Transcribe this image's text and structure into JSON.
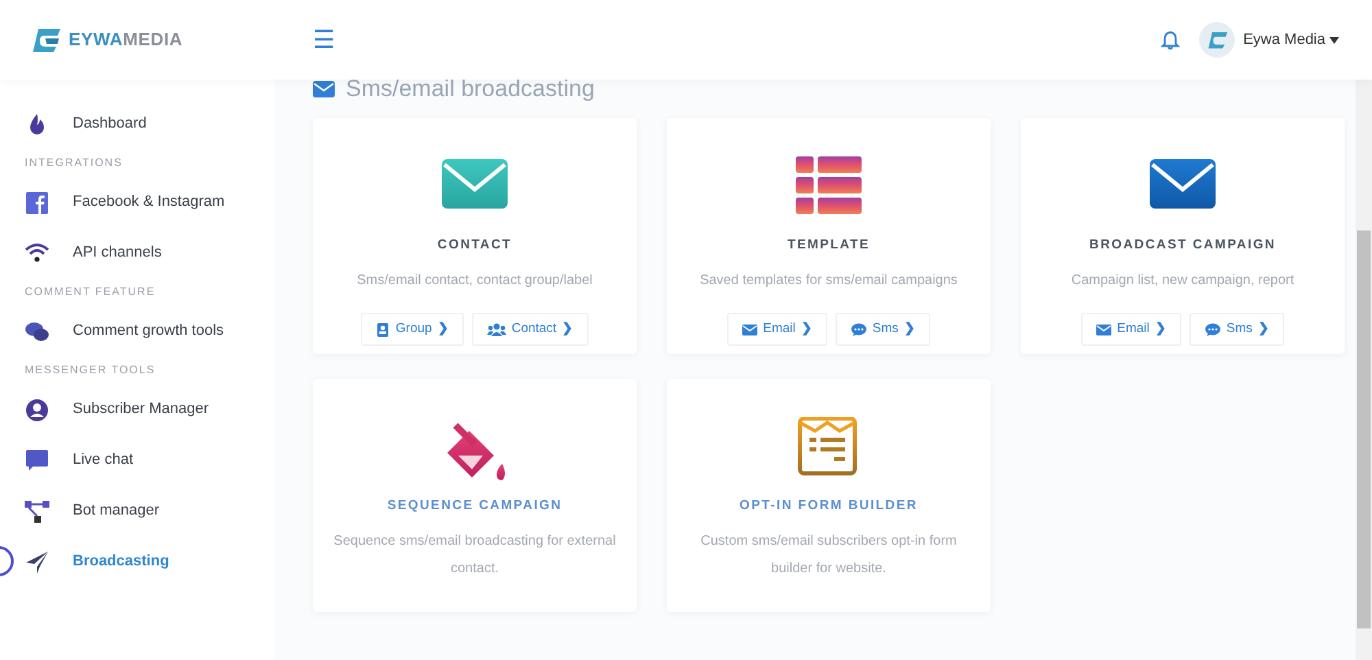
{
  "brand": {
    "logo_text_a": "EYWA",
    "logo_text_b": "MEDIA"
  },
  "header": {
    "menu_icon": "☰",
    "user_name": "Eywa Media"
  },
  "sidebar": {
    "items": [
      {
        "kind": "item",
        "label": "Dashboard",
        "selected": false
      },
      {
        "kind": "section",
        "label": "INTEGRATIONS"
      },
      {
        "kind": "item",
        "label": "Facebook & Instagram",
        "selected": false
      },
      {
        "kind": "item",
        "label": "API channels",
        "selected": false
      },
      {
        "kind": "section",
        "label": "COMMENT FEATURE"
      },
      {
        "kind": "item",
        "label": "Comment growth tools",
        "selected": false
      },
      {
        "kind": "section",
        "label": "MESSENGER TOOLS"
      },
      {
        "kind": "item",
        "label": "Subscriber Manager",
        "selected": false
      },
      {
        "kind": "item",
        "label": "Live chat",
        "selected": false
      },
      {
        "kind": "item",
        "label": "Bot manager",
        "selected": false
      },
      {
        "kind": "item",
        "label": "Broadcasting",
        "selected": true
      }
    ]
  },
  "page_title": "Sms/email broadcasting",
  "cards": [
    {
      "title": "CONTACT",
      "color": "#4a5563",
      "description": "Sms/email contact, contact group/label",
      "buttons": [
        {
          "kind": "group",
          "label": "Group",
          "arrow": "❯"
        },
        {
          "kind": "contact",
          "label": "Contact",
          "arrow": "❯"
        }
      ]
    },
    {
      "title": "TEMPLATE",
      "color": "#4a5563",
      "description": "Saved templates for sms/email campaigns",
      "buttons": [
        {
          "kind": "email",
          "label": "Email",
          "arrow": "❯"
        },
        {
          "kind": "sms",
          "label": "Sms",
          "arrow": "❯"
        }
      ]
    },
    {
      "title": "BROADCAST CAMPAIGN",
      "color": "#4a5563",
      "description": "Campaign list, new campaign, report",
      "buttons": [
        {
          "kind": "email",
          "label": "Email",
          "arrow": "❯"
        },
        {
          "kind": "sms",
          "label": "Sms",
          "arrow": "❯"
        }
      ]
    },
    {
      "title": "SEQUENCE CAMPAIGN",
      "color": "#5b8fd0",
      "description": "Sequence sms/email broadcasting for external contact."
    },
    {
      "title": "OPT-IN FORM BUILDER",
      "color": "#5b8fd0",
      "description": "Custom sms/email subscribers opt-in form builder for website."
    }
  ]
}
